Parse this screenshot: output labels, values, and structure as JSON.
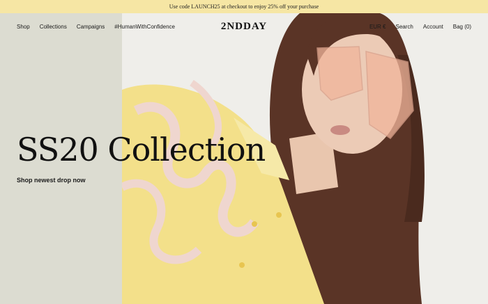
{
  "announcement": {
    "text": "Use code LAUNCH25 at checkout to enjoy 25% off your purchase"
  },
  "brand": {
    "logo": "2NDDAY"
  },
  "nav": {
    "left": [
      "Shop",
      "Collections",
      "Campaigns",
      "#HumanWithConfidence"
    ],
    "right": [
      "EUR €",
      "Search",
      "Account",
      "Bag (0)"
    ]
  },
  "hero": {
    "headline": "SS20 Collection",
    "cta": "Shop newest drop now"
  },
  "colors": {
    "announcement_bg": "#f6e6a4",
    "left_panel": "#dcdcd1",
    "photo_bg": "#efeeea",
    "shirt_yellow": "#f3e08a"
  }
}
